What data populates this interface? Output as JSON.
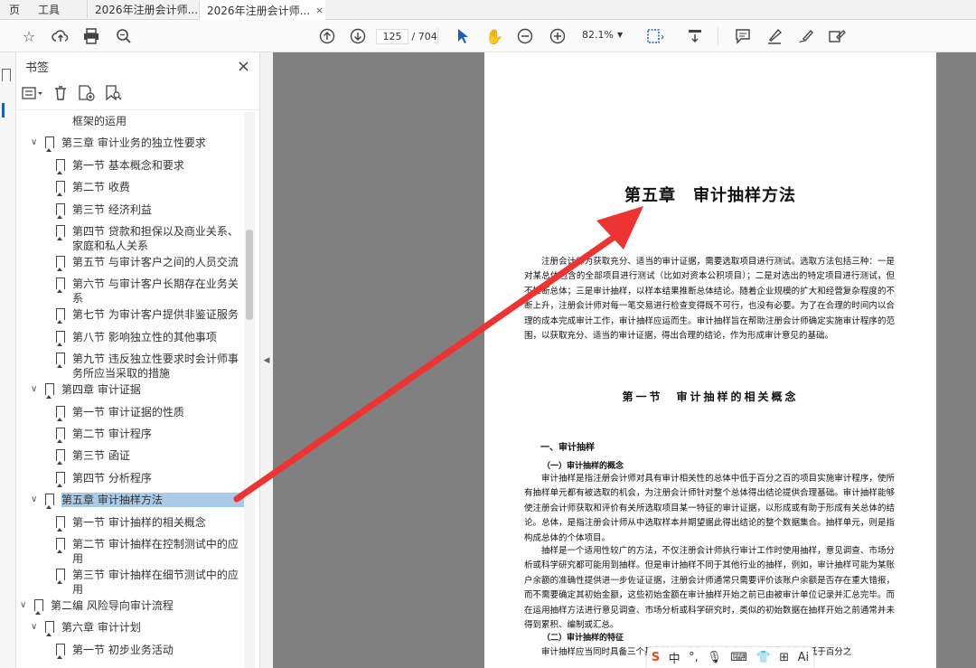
{
  "tabs": {
    "menu1": "页",
    "menu2": "工具",
    "doc1": "2026年注册会计师...",
    "doc2": "2026年注册会计师...",
    "close": "×"
  },
  "toolbar": {
    "page_current": "125",
    "page_total": "/ 704",
    "zoom": "82.1%"
  },
  "panel": {
    "title": "书签",
    "close": "×"
  },
  "bookmarks": [
    {
      "label": "框架的运用",
      "level": 3,
      "chev": "",
      "mark": false
    },
    {
      "label": "第三章 审计业务的独立性要求",
      "level": 2,
      "chev": "∨",
      "mark": true
    },
    {
      "label": "第一节 基本概念和要求",
      "level": 3,
      "chev": "",
      "mark": true
    },
    {
      "label": "第二节 收费",
      "level": 3,
      "chev": "",
      "mark": true
    },
    {
      "label": "第三节 经济利益",
      "level": 3,
      "chev": "",
      "mark": true
    },
    {
      "label": "第四节 贷款和担保以及商业关系、家庭和私人关系",
      "level": 3,
      "chev": "",
      "mark": true
    },
    {
      "label": "第五节 与审计客户之间的人员交流",
      "level": 3,
      "chev": "",
      "mark": true
    },
    {
      "label": "第六节 与审计客户长期存在业务关系",
      "level": 3,
      "chev": "",
      "mark": true
    },
    {
      "label": "第七节 为审计客户提供非鉴证服务",
      "level": 3,
      "chev": "",
      "mark": true
    },
    {
      "label": "第八节 影响独立性的其他事项",
      "level": 3,
      "chev": "",
      "mark": true
    },
    {
      "label": "第九节 违反独立性要求时会计师事务所应当采取的措施",
      "level": 3,
      "chev": "",
      "mark": true
    },
    {
      "label": "第四章 审计证据",
      "level": 2,
      "chev": "∨",
      "mark": true
    },
    {
      "label": "第一节 审计证据的性质",
      "level": 3,
      "chev": "",
      "mark": true
    },
    {
      "label": "第二节 审计程序",
      "level": 3,
      "chev": "",
      "mark": true
    },
    {
      "label": "第三节 函证",
      "level": 3,
      "chev": "",
      "mark": true
    },
    {
      "label": "第四节 分析程序",
      "level": 3,
      "chev": "",
      "mark": true
    },
    {
      "label": "第五章 审计抽样方法",
      "level": 2,
      "chev": "∨",
      "mark": true,
      "selected": true
    },
    {
      "label": "第一节 审计抽样的相关概念",
      "level": 3,
      "chev": "",
      "mark": true
    },
    {
      "label": "第二节 审计抽样在控制测试中的应用",
      "level": 3,
      "chev": "",
      "mark": true
    },
    {
      "label": "第三节 审计抽样在细节测试中的应用",
      "level": 3,
      "chev": "",
      "mark": true
    },
    {
      "label": "第二编 风险导向审计流程",
      "level": 1,
      "chev": "∨",
      "mark": true
    },
    {
      "label": "第六章 审计计划",
      "level": 2,
      "chev": "∨",
      "mark": true
    },
    {
      "label": "第一节 初步业务活动",
      "level": 3,
      "chev": "",
      "mark": true
    }
  ],
  "document": {
    "chapter_title": "第五章　审计抽样方法",
    "intro": "注册会计师为获取充分、适当的审计证据，需要选取项目进行测试。选取方法包括三种：一是对某总体包含的全部项目进行测试（比如对资本公积项目）；二是对选出的特定项目进行测试，但不推断总体；三是审计抽样，以样本结果推断总体结论。随着企业规模的扩大和经营复杂程度的不断上升，注册会计师对每一笔交易进行检查变得既不可行，也没有必要。为了在合理的时间内以合理的成本完成审计工作，审计抽样应运而生。审计抽样旨在帮助注册会计师确定实施审计程序的范围，以获取充分、适当的审计证据，得出合理的结论，作为形成审计意见的基础。",
    "section_title": "第一节　审计抽样的相关概念",
    "heading1": "一、审计抽样",
    "heading2a": "（一）审计抽样的概念",
    "body1": "审计抽样是指注册会计师对具有审计相关性的总体中低于百分之百的项目实施审计程序，使所有抽样单元都有被选取的机会，为注册会计师针对整个总体得出结论提供合理基础。审计抽样能够使注册会计师获取和评价有关所选取项目某一特征的审计证据，以形成或有助于形成有关总体的结论。总体，是指注册会计师从中选取样本并期望据此得出结论的整个数据集合。抽样单元，则是指构成总体的个体项目。",
    "body2": "抽样是一个适用性较广的方法，不仅注册会计师执行审计工作时使用抽样，意见调查、市场分析或科学研究都可能用到抽样。但是审计抽样不同于其他行业的抽样，例如，审计抽样可能为某账户余额的准确性提供进一步佐证证据，注册会计师通常只需要评价该账户余额是否存在重大错报，而不需要确定其初始金额，这些初始金额在审计抽样开始之前已由被审计单位记录并汇总完毕。而在运用抽样方法进行意见调查、市场分析或科学研究时，类似的初始数据在抽样开始之前通常并未得到累积、编制或汇总。",
    "heading2b": "（二）审计抽样的特征",
    "body3": "审计抽样应当同时具备三个基本特征：（1）对具有审计相关性的总体中低于百分之"
  },
  "ime": {
    "logo": "S",
    "lang": "中",
    "ai": "Ai"
  },
  "colors": {
    "arrow": "#ee3333",
    "selection": "#a9cbe8",
    "viewer_bg": "#808080"
  }
}
